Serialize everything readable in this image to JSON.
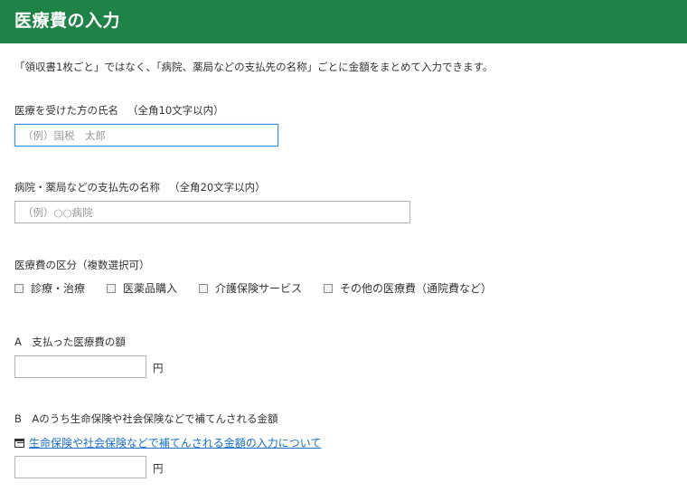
{
  "header": {
    "title": "医療費の入力"
  },
  "intro": "「領収書1枚ごと」ではなく、「病院、薬局などの支払先の名称」ごとに金額をまとめて入力できます。",
  "patient_name": {
    "label": "医療を受けた方の氏名",
    "note": "（全角10文字以内）",
    "placeholder": "（例）国税　太郎"
  },
  "payee_name": {
    "label": "病院・薬局などの支払先の名称",
    "note": "（全角20文字以内）",
    "placeholder": "（例）○○病院"
  },
  "category": {
    "label": "医療費の区分（複数選択可）",
    "options": [
      "診療・治療",
      "医薬品購入",
      "介護保険サービス",
      "その他の医療費（通院費など）"
    ]
  },
  "amount_a": {
    "label": "A　支払った医療費の額",
    "unit": "円"
  },
  "amount_b": {
    "label": "B　Aのうち生命保険や社会保険などで補てんされる金額",
    "link": "生命保険や社会保険などで補てんされる金額の入力について",
    "unit": "円"
  },
  "colors": {
    "header_bg": "#1f8246",
    "link": "#1a6fc9",
    "focus_border": "#3a8ee6"
  }
}
